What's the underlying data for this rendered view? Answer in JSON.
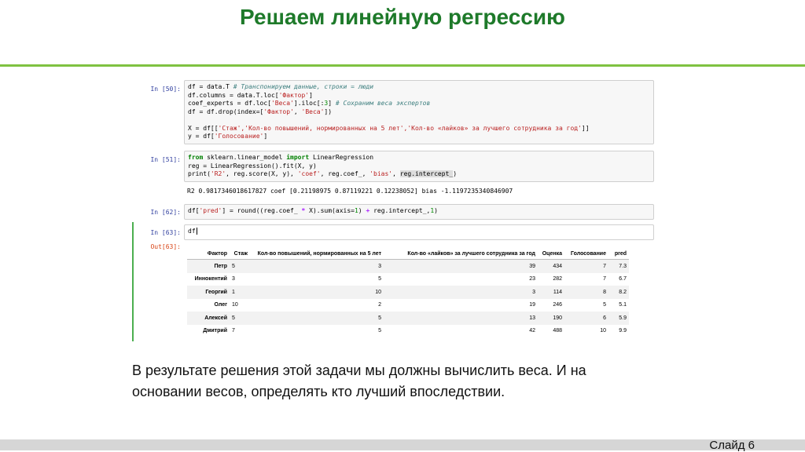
{
  "slide": {
    "title": "Решаем линейную регрессию",
    "caption_line1": "В результате решения этой задачи мы должны вычислить веса. И на",
    "caption_line2": "основании весов, определять кто лучший впоследствии.",
    "slide_number": "Слайд 6"
  },
  "cells": {
    "c50": {
      "prompt": "In [50]:",
      "l1_code": "df = data.T ",
      "l1_comment": "# Транспонируем данные, строки = люди",
      "l2_a": "df.columns = data.T.loc[",
      "l2_str": "'Фактор'",
      "l2_b": "]",
      "l3_a": "coef_experts = df.loc[",
      "l3_str": "'Веса'",
      "l3_b": "].iloc[:",
      "l3_num": "3",
      "l3_c": "] ",
      "l3_comment": "# Сохраним веса экспертов",
      "l4_a": "df = df.drop(index=[",
      "l4_s1": "'Фактор'",
      "l4_sep": ", ",
      "l4_s2": "'Веса'",
      "l4_b": "])",
      "l6_a": "X = df[[",
      "l6_str": "'Стаж','Кол-во повышений, нормированных на 5 лет','Кол-во «лайков» за лучшего сотрудника за год'",
      "l6_b": "]]",
      "l7_a": "y = df[",
      "l7_str": "'Голосование'",
      "l7_b": "]"
    },
    "c51": {
      "prompt": "In [51]:",
      "l1_from": "from",
      "l1_mod": " sklearn.linear_model ",
      "l1_import": "import",
      "l1_name": " LinearRegression",
      "l2": "reg = LinearRegression().fit(X, y)",
      "l3_a": "print(",
      "l3_s1": "'R2'",
      "l3_b": ", reg.score(X, y), ",
      "l3_s2": "'coef'",
      "l3_c": ", reg.coef_, ",
      "l3_s3": "'bias'",
      "l3_d": ", ",
      "l3_hl": "reg.intercept_",
      "l3_e": ")",
      "output": "R2 0.9817346018617827 coef [0.21198975 0.87119221 0.12238052] bias -1.1197235340846907"
    },
    "c62": {
      "prompt": "In [62]:",
      "a": "df[",
      "s1": "'pred'",
      "b": "] = round((reg.coef_ ",
      "op1": "*",
      "c": " X).sum(axis=",
      "n1": "1",
      "d": ") ",
      "op2": "+",
      "e": " reg.intercept_,",
      "n2": "1",
      "f": ")"
    },
    "c63": {
      "prompt": "In [63]:",
      "code": "df",
      "out_prompt": "Out[63]:"
    }
  },
  "dataframe": {
    "columns": [
      "Фактор",
      "Стаж",
      "Кол-во повышений, нормированных на 5 лет",
      "Кол-во «лайков» за лучшего сотрудника за год",
      "Оценка",
      "Голосование",
      "pred"
    ],
    "rows": [
      [
        "Петр",
        "5",
        "3",
        "39",
        "434",
        "7",
        "7.3"
      ],
      [
        "Иннокентий",
        "3",
        "5",
        "23",
        "282",
        "7",
        "6.7"
      ],
      [
        "Георгий",
        "1",
        "10",
        "3",
        "114",
        "8",
        "8.2"
      ],
      [
        "Олег",
        "10",
        "2",
        "19",
        "246",
        "5",
        "5.1"
      ],
      [
        "Алексей",
        "5",
        "5",
        "13",
        "190",
        "6",
        "5.9"
      ],
      [
        "Дмитрий",
        "7",
        "5",
        "42",
        "488",
        "10",
        "9.9"
      ]
    ]
  },
  "colors": {
    "title": "#1e7a2a",
    "rule": "#7fc241",
    "selected_cell_bar": "#4caf50"
  }
}
